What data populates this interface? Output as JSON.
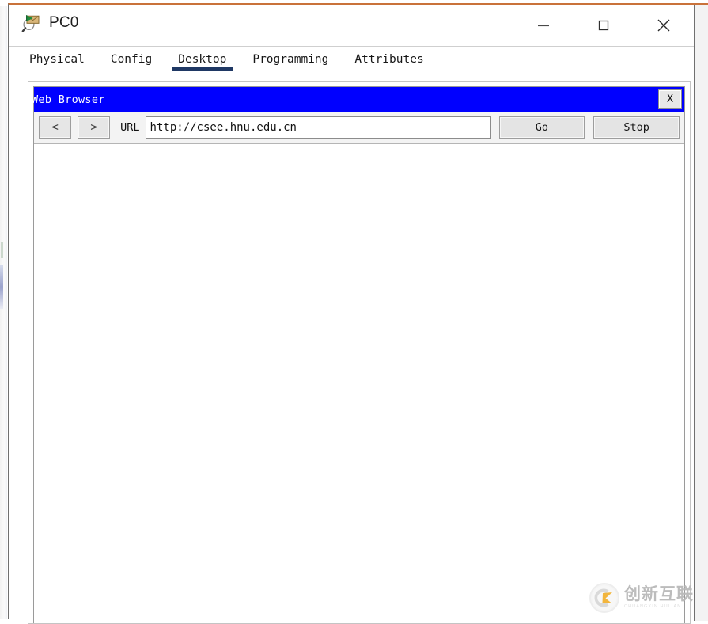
{
  "window": {
    "title": "PC0",
    "app_icon": "packet-tracer-pc-icon",
    "controls": {
      "minimize": "minimize-icon",
      "maximize": "maximize-icon",
      "close": "close-icon"
    }
  },
  "tabs": [
    {
      "label": "Physical",
      "selected": false
    },
    {
      "label": "Config",
      "selected": false
    },
    {
      "label": "Desktop",
      "selected": true
    },
    {
      "label": "Programming",
      "selected": false
    },
    {
      "label": "Attributes",
      "selected": false
    }
  ],
  "browser": {
    "title": "Web Browser",
    "close_label": "X",
    "toolbar": {
      "back_label": "<",
      "forward_label": ">",
      "url_label": "URL",
      "url_value": "http://csee.hnu.edu.cn",
      "url_placeholder": "",
      "go_label": "Go",
      "stop_label": "Stop"
    },
    "page_content": ""
  },
  "watermark": {
    "cn_text": "创新互联",
    "en_text": "CHUANGXIN HULIAN",
    "logo": "cx-logo-icon"
  },
  "colors": {
    "browser_titlebar": "#0000ff",
    "tab_underline": "#1f3864",
    "window_top_accent": "#c9723a",
    "panel_border": "#c4c4c4"
  }
}
